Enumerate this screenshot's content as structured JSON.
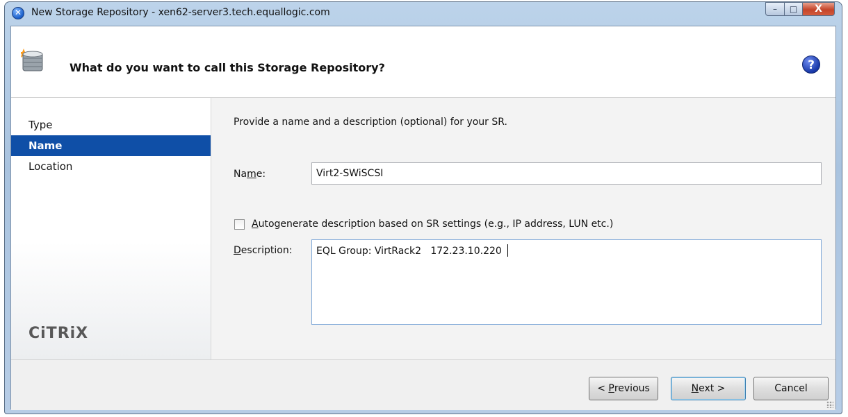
{
  "window": {
    "title": "New Storage Repository - xen62-server3.tech.equallogic.com",
    "app_icon_glyph": "x-circle-icon",
    "controls": {
      "minimize": "–",
      "maximize": "□",
      "close": "X"
    }
  },
  "header": {
    "title": "What do you want to call this Storage Repository?",
    "icon": "storage-disk-icon",
    "help_glyph": "?"
  },
  "sidebar": {
    "items": [
      {
        "label": "Type",
        "active": false
      },
      {
        "label": "Name",
        "active": true
      },
      {
        "label": "Location",
        "active": false
      }
    ],
    "logo": "CiTRiX"
  },
  "content": {
    "intro": "Provide a name and a description (optional) for your SR.",
    "name_label_pre": "Na",
    "name_label_accel": "m",
    "name_label_post": "e:",
    "name_value": "Virt2-SWiSCSI",
    "autogen_accel": "A",
    "autogen_label_rest": "utogenerate description based on SR settings (e.g., IP address, LUN etc.)",
    "autogen_checked": false,
    "desc_label_accel": "D",
    "desc_label_rest": "escription:",
    "desc_value": "EQL Group: VirtRack2   172.23.10.220"
  },
  "footer": {
    "prev_pre": "< ",
    "prev_accel": "P",
    "prev_rest": "revious",
    "next_accel": "N",
    "next_rest": "ext >",
    "cancel": "Cancel"
  },
  "colors": {
    "selection": "#0f4fa7",
    "titlebar": "#bcd3ea",
    "close_button": "#c4452b"
  }
}
